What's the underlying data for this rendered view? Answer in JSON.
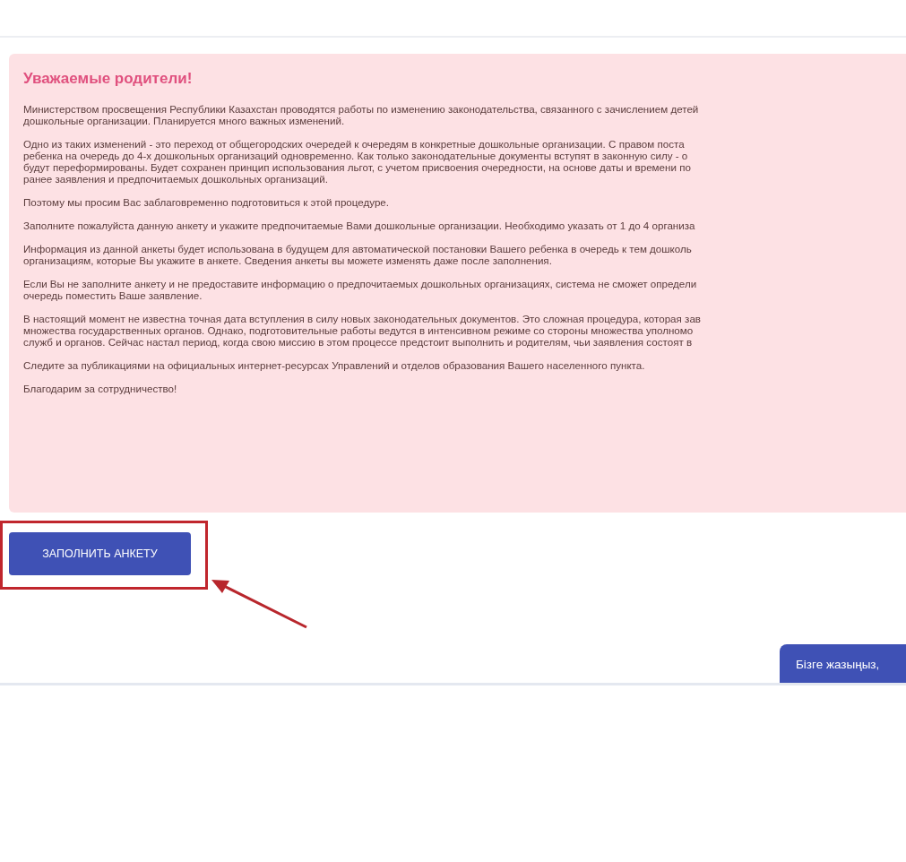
{
  "notice": {
    "title": "Уважаемые родители!",
    "paragraphs": [
      [
        "Министерством просвещения Республики Казахстан проводятся работы по изменению законодательства, связанного с зачислением детей",
        "дошкольные организации. Планируется много важных изменений."
      ],
      [
        "Одно из таких изменений - это переход от общегородских очередей к очередям в конкретные дошкольные организации. С правом поста",
        "ребенка на очередь до 4-х дошкольных организаций одновременно. Как только законодательные документы вступят в законную силу - о",
        "будут переформированы. Будет сохранен принцип использования льгот, с учетом присвоения очередности, на основе даты и времени по",
        "ранее заявления и предпочитаемых дошкольных организаций."
      ],
      [
        "Поэтому мы просим Вас заблаговременно подготовиться к этой процедуре."
      ],
      [
        "Заполните пожалуйста данную анкету и укажите предпочитаемые Вами дошкольные организации. Необходимо указать от 1 до 4 организа"
      ],
      [
        "Информация из данной анкеты будет использована в будущем для автоматической постановки Вашего ребенка в очередь к тем дошколь",
        "организациям, которые Вы укажите в анкете. Сведения анкеты вы можете изменять даже после заполнения."
      ],
      [
        "Если Вы не заполните анкету и не предоставите информацию о предпочитаемых дошкольных организациях, система не сможет определи",
        "очередь поместить Ваше заявление."
      ],
      [
        "В настоящий момент не известна точная дата вступления в силу новых законодательных документов. Это сложная процедура, которая зав",
        "множества государственных органов. Однако, подготовительные работы ведутся в интенсивном режиме со стороны множества уполномо",
        "служб и органов. Сейчас настал период, когда свою миссию в этом процессе предстоит выполнить и родителям, чьи заявления состоят в"
      ],
      [
        "Следите за публикациями на официальных интернет-ресурсах Управлений и отделов образования Вашего населенного пункта."
      ],
      [
        "Благодарим за сотрудничество!"
      ]
    ]
  },
  "button": {
    "label": "ЗАПОЛНИТЬ АНКЕТУ"
  },
  "chat_button": {
    "label": "Бізге жазыңыз,"
  }
}
